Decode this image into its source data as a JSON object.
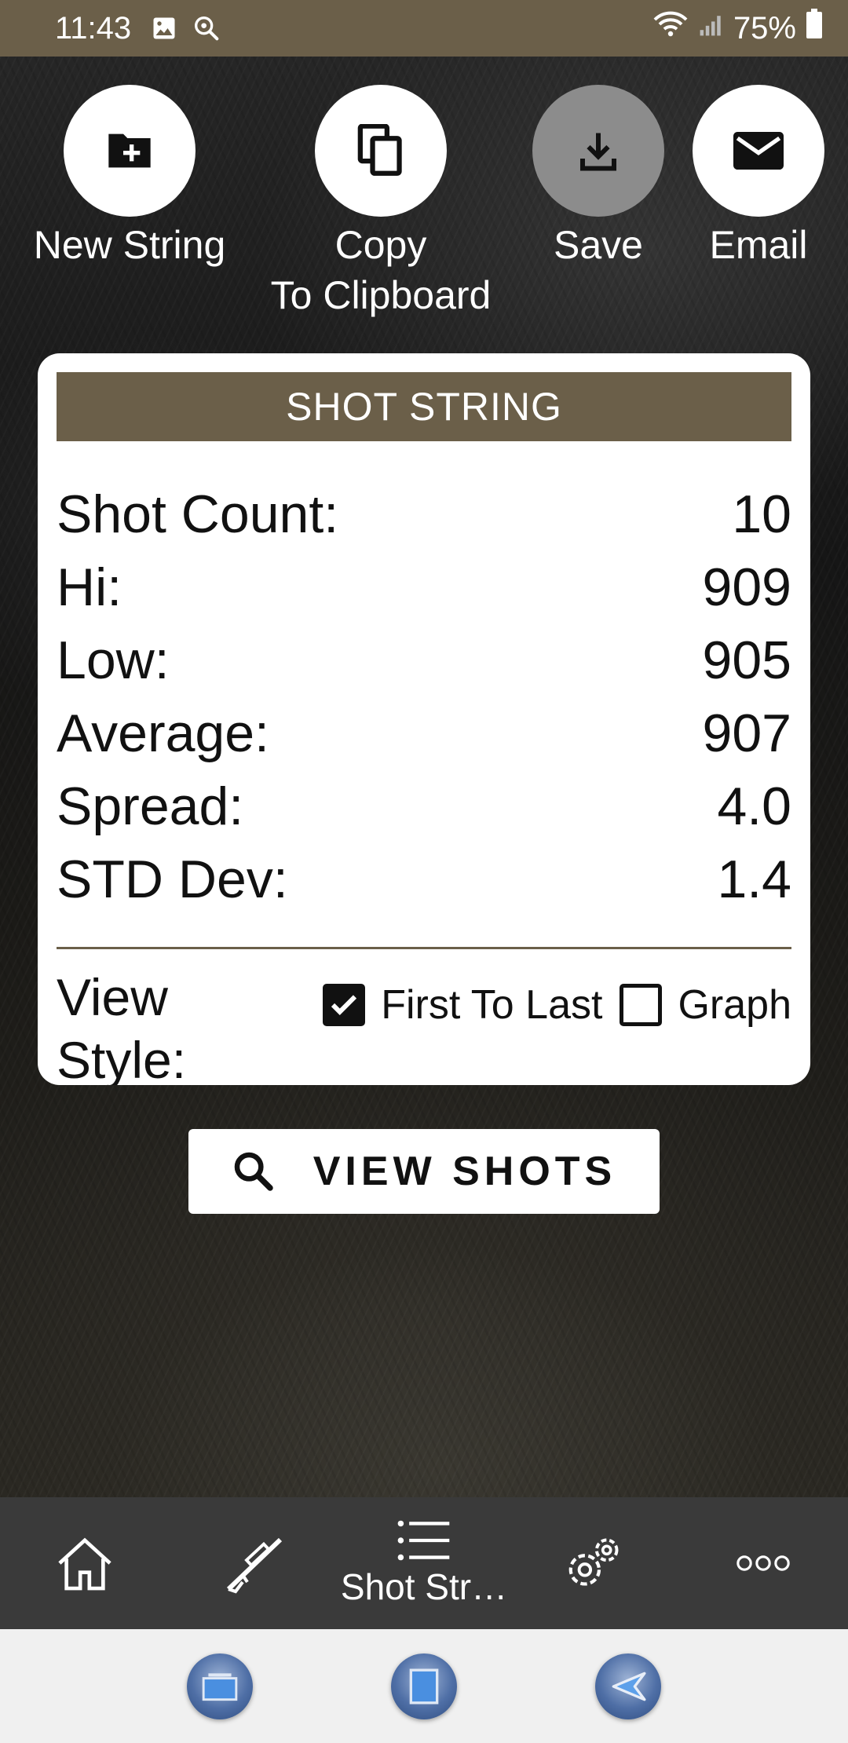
{
  "status_bar": {
    "time": "11:43",
    "battery": "75%"
  },
  "actions": {
    "new_string": "New String",
    "copy_line1": "Copy",
    "copy_line2": "To Clipboard",
    "save": "Save",
    "email": "Email"
  },
  "card": {
    "title": "SHOT STRING",
    "stats": [
      {
        "label": "Shot Count:",
        "value": "10"
      },
      {
        "label": "Hi:",
        "value": "909"
      },
      {
        "label": "Low:",
        "value": "905"
      },
      {
        "label": "Average:",
        "value": "907"
      },
      {
        "label": "Spread:",
        "value": "4.0"
      },
      {
        "label": "STD Dev:",
        "value": "1.4"
      }
    ],
    "view_style_label": "View Style:",
    "options": {
      "first_to_last": {
        "label": "First To Last",
        "checked": true
      },
      "graph": {
        "label": "Graph",
        "checked": false
      }
    }
  },
  "view_shots_button": "VIEW SHOTS",
  "tabs": {
    "home_icon": "home-icon",
    "rifle_icon": "rifle-icon",
    "shot_strings_label": "Shot Str…",
    "settings_icon": "gears-icon",
    "more_icon": "more-icon"
  },
  "colors": {
    "brand": "#6b5f49",
    "tabbar": "#3a3a3a"
  }
}
